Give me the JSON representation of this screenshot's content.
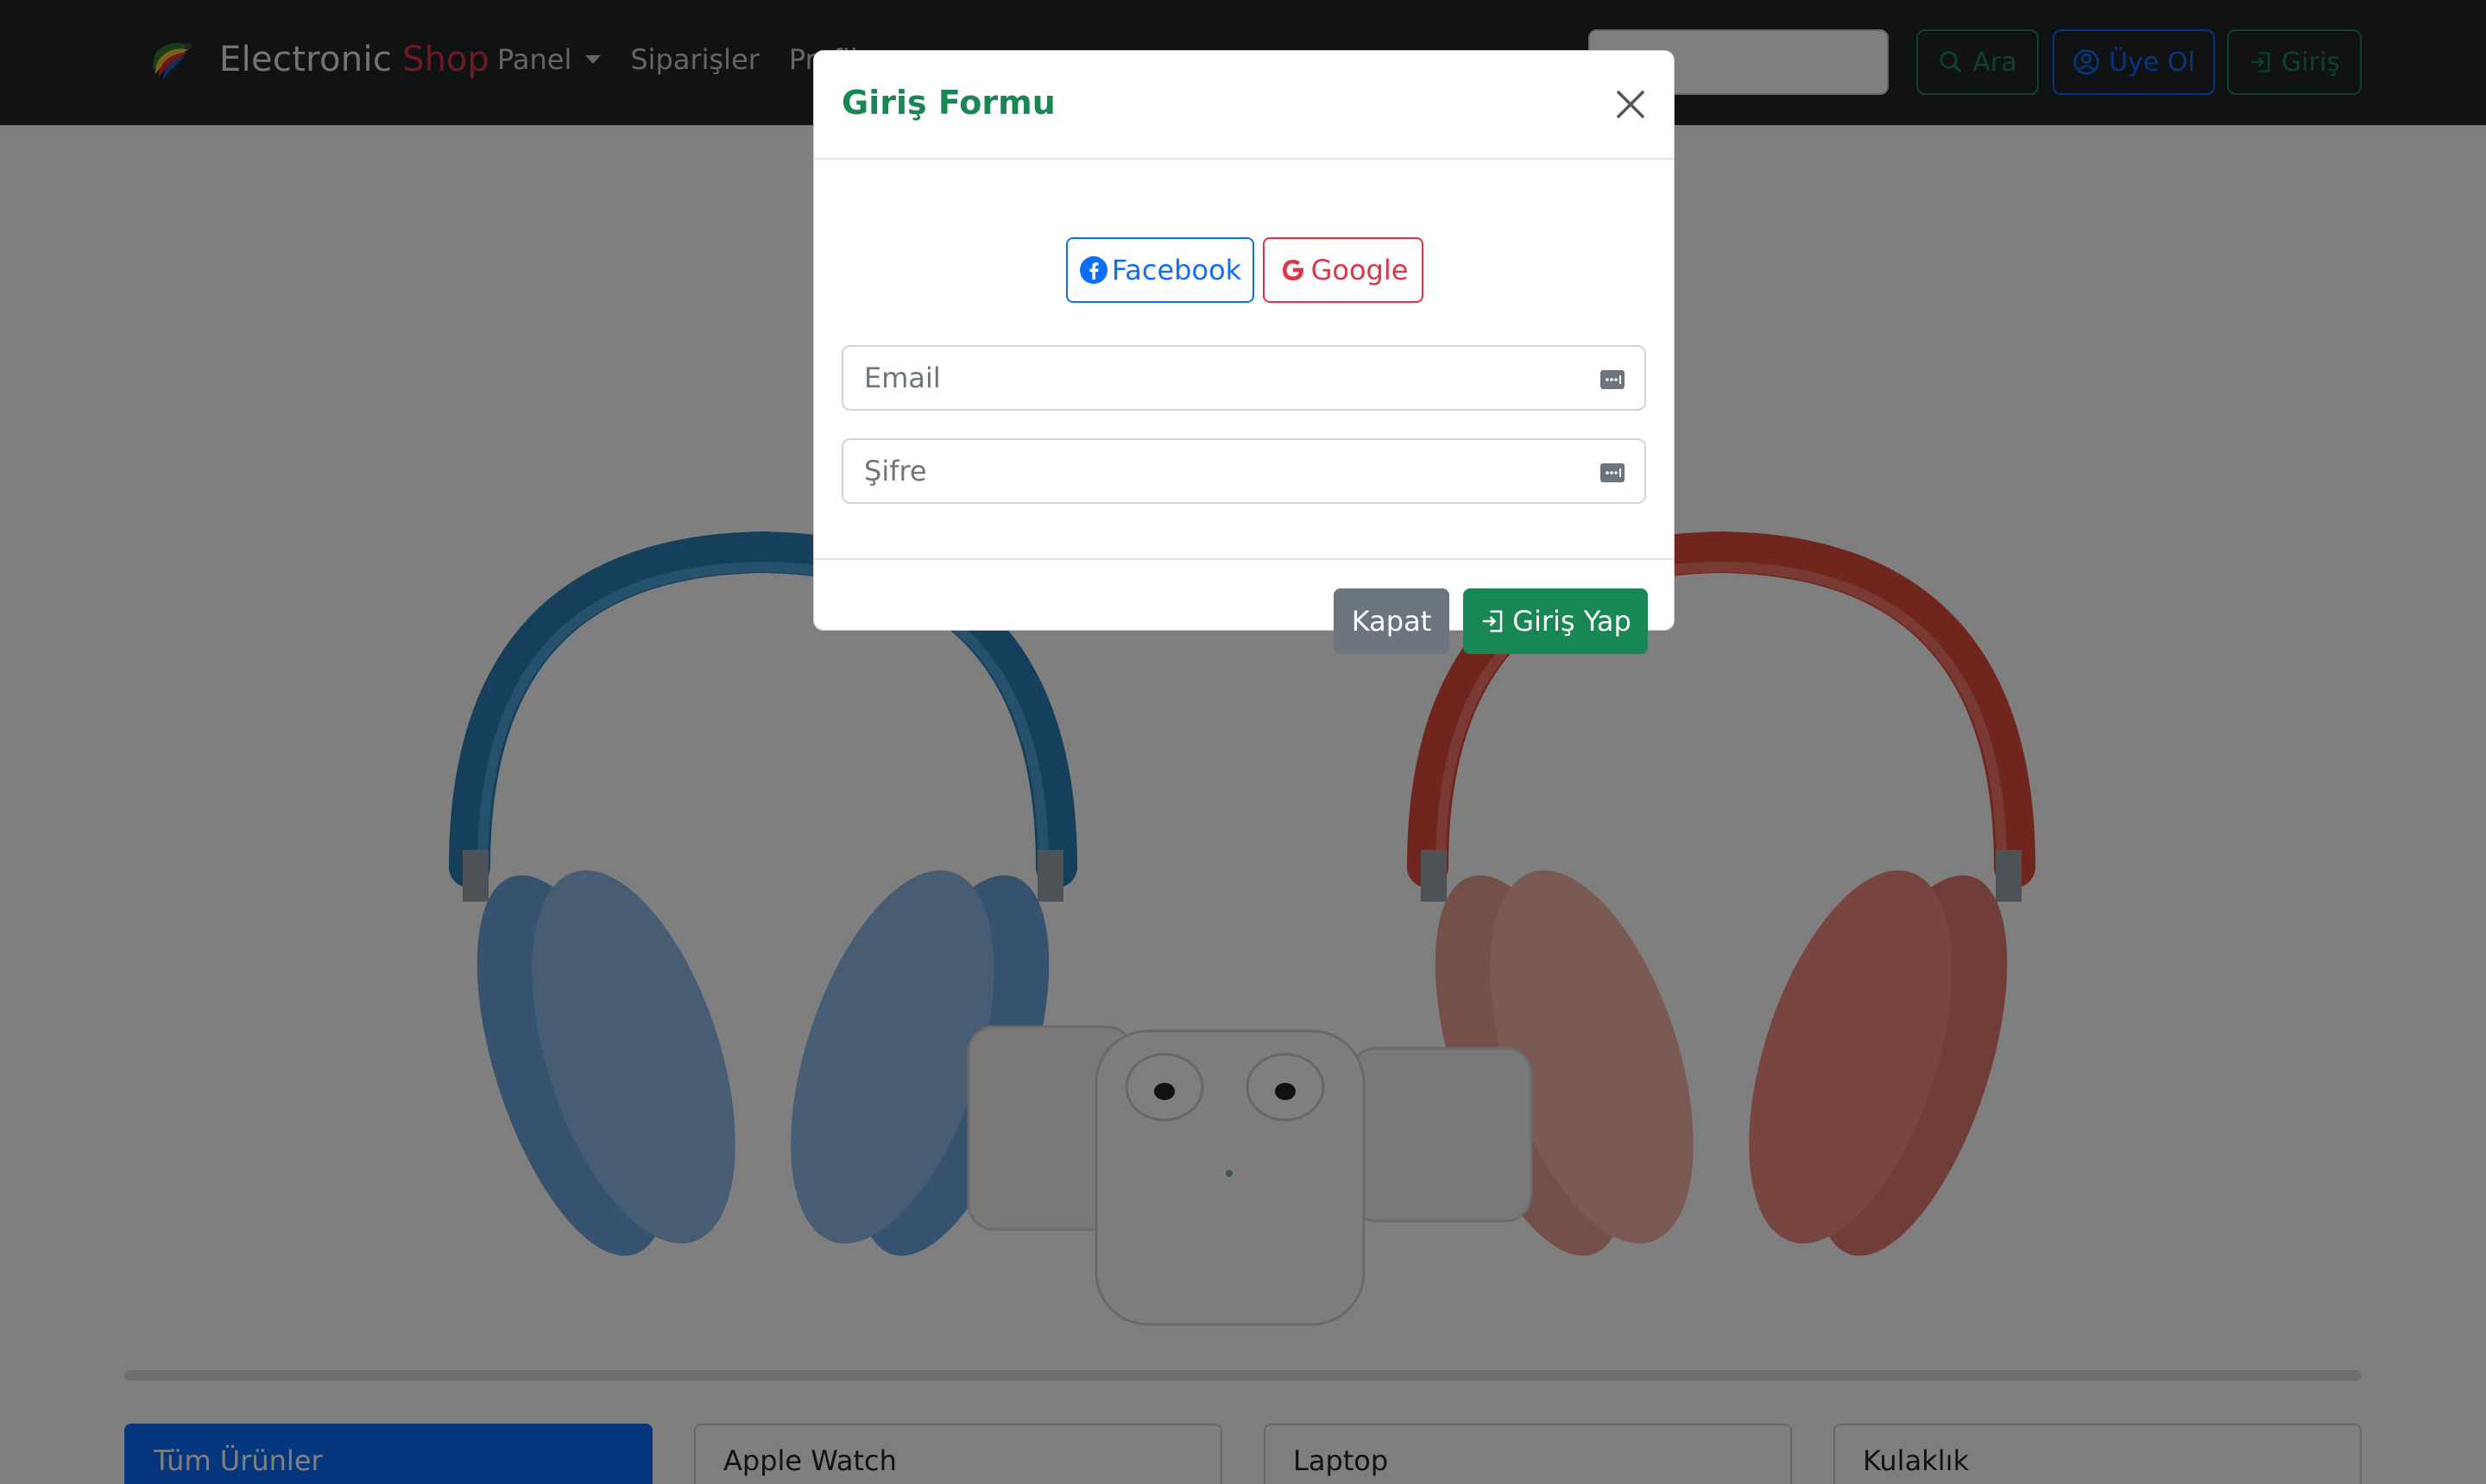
{
  "brand": {
    "name": "Electronic",
    "accent": "Shop",
    "logo_icon": "colorful-wing-logo"
  },
  "nav": {
    "items": [
      {
        "label": "Panel",
        "dropdown": true
      },
      {
        "label": "Siparişler"
      },
      {
        "label": "Profil"
      }
    ]
  },
  "search": {
    "placeholder": "Ara",
    "button_label": "Ara",
    "button_icon": "search-icon"
  },
  "auth": {
    "register_label": "Üye Ol",
    "register_icon": "user-circle-icon",
    "login_label": "Giriş",
    "login_icon": "sign-in-icon"
  },
  "categories": [
    {
      "label": "Tüm Ürünler",
      "active": true
    },
    {
      "label": "Apple Watch"
    },
    {
      "label": "Laptop"
    },
    {
      "label": "Kulaklık"
    }
  ],
  "modal": {
    "title": "Giriş Formu",
    "social": {
      "facebook_label": "Facebook",
      "google_label": "Google"
    },
    "fields": {
      "email_placeholder": "Email",
      "password_placeholder": "Şifre"
    },
    "buttons": {
      "close_label": "Kapat",
      "submit_label": "Giriş Yap"
    }
  },
  "colors": {
    "navbar": "#212529",
    "accent_red": "#dc3545",
    "primary": "#0d6efd",
    "success": "#198754",
    "secondary": "#6c757d"
  }
}
